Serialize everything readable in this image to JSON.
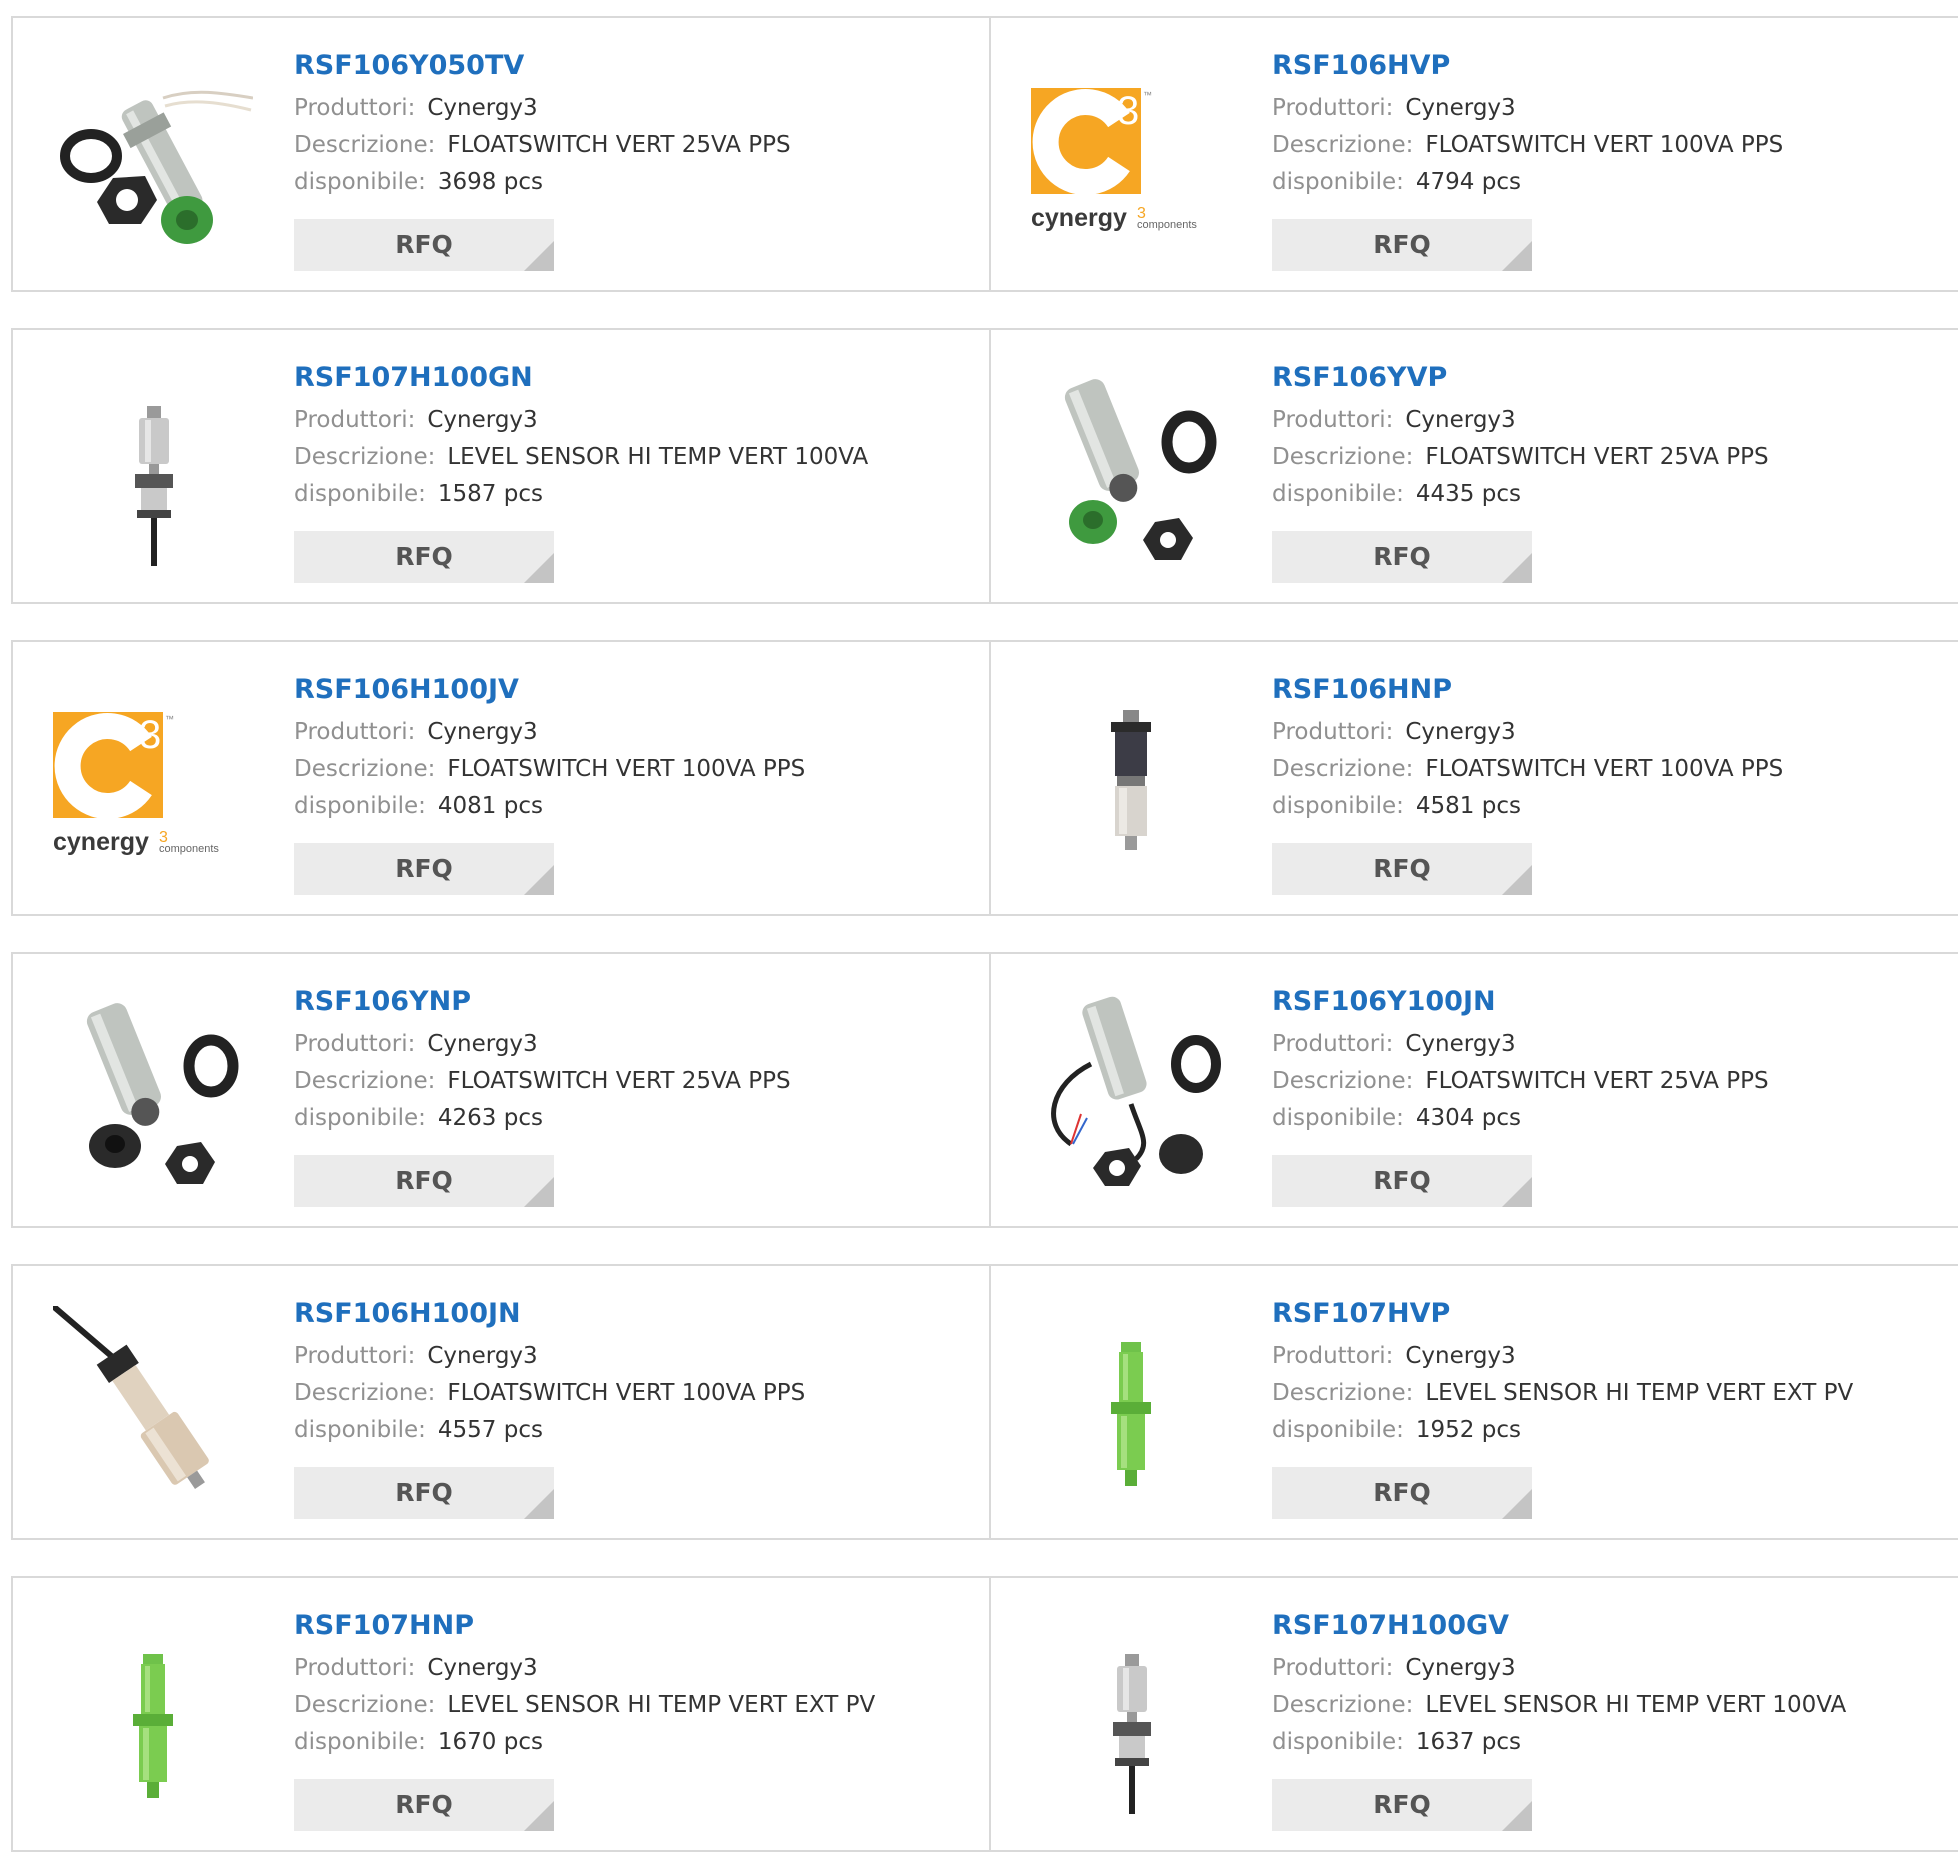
{
  "labels": {
    "manufacturer": "Produttori:",
    "description": "Descrizione:",
    "available": "disponibile:",
    "rfq": "RFQ"
  },
  "products": [
    {
      "name": "RSF106Y050TV",
      "manufacturer": "Cynergy3",
      "description": "FLOATSWITCH VERT 25VA PPS",
      "available": "3698 pcs",
      "image": "float-switch-kit-with-wires"
    },
    {
      "name": "RSF106HVP",
      "manufacturer": "Cynergy3",
      "description": "FLOATSWITCH VERT 100VA PPS",
      "available": "4794 pcs",
      "image": "cynergy3-logo"
    },
    {
      "name": "RSF107H100GN",
      "manufacturer": "Cynergy3",
      "description": "LEVEL SENSOR HI TEMP VERT 100VA",
      "available": "1587 pcs",
      "image": "vertical-level-sensor-with-cable"
    },
    {
      "name": "RSF106YVP",
      "manufacturer": "Cynergy3",
      "description": "FLOATSWITCH VERT 25VA PPS",
      "available": "4435 pcs",
      "image": "float-switch-kit-green-float"
    },
    {
      "name": "RSF106H100JV",
      "manufacturer": "Cynergy3",
      "description": "FLOATSWITCH VERT 100VA PPS",
      "available": "4081 pcs",
      "image": "cynergy3-logo"
    },
    {
      "name": "RSF106HNP",
      "manufacturer": "Cynergy3",
      "description": "FLOATSWITCH VERT 100VA PPS",
      "available": "4581 pcs",
      "image": "vertical-float-switch-black-grey"
    },
    {
      "name": "RSF106YNP",
      "manufacturer": "Cynergy3",
      "description": "FLOATSWITCH VERT 25VA PPS",
      "available": "4263 pcs",
      "image": "float-switch-kit-black-float"
    },
    {
      "name": "RSF106Y100JN",
      "manufacturer": "Cynergy3",
      "description": "FLOATSWITCH VERT 25VA PPS",
      "available": "4304 pcs",
      "image": "float-switch-kit-with-cable"
    },
    {
      "name": "RSF106H100JN",
      "manufacturer": "Cynergy3",
      "description": "FLOATSWITCH VERT 100VA PPS",
      "available": "4557 pcs",
      "image": "angled-float-switch-with-cable"
    },
    {
      "name": "RSF107HVP",
      "manufacturer": "Cynergy3",
      "description": "LEVEL SENSOR HI TEMP VERT EXT PV",
      "available": "1952 pcs",
      "image": "green-level-sensor"
    },
    {
      "name": "RSF107HNP",
      "manufacturer": "Cynergy3",
      "description": "LEVEL SENSOR HI TEMP VERT EXT PV",
      "available": "1670 pcs",
      "image": "green-level-sensor"
    },
    {
      "name": "RSF107H100GV",
      "manufacturer": "Cynergy3",
      "description": "LEVEL SENSOR HI TEMP VERT 100VA",
      "available": "1637 pcs",
      "image": "vertical-level-sensor-with-cable"
    }
  ],
  "logo": {
    "letter": "c",
    "superscript": "3",
    "wordmark": "cynergy",
    "wordmark_sup": "3",
    "wordmark_small": "components",
    "tm": "™"
  },
  "colors": {
    "link": "#1f6fbd",
    "label": "#909090",
    "value": "#333333",
    "button_bg": "#ebebeb",
    "button_text": "#555555",
    "border": "#d9d9d9",
    "logo_orange": "#f6a623"
  }
}
